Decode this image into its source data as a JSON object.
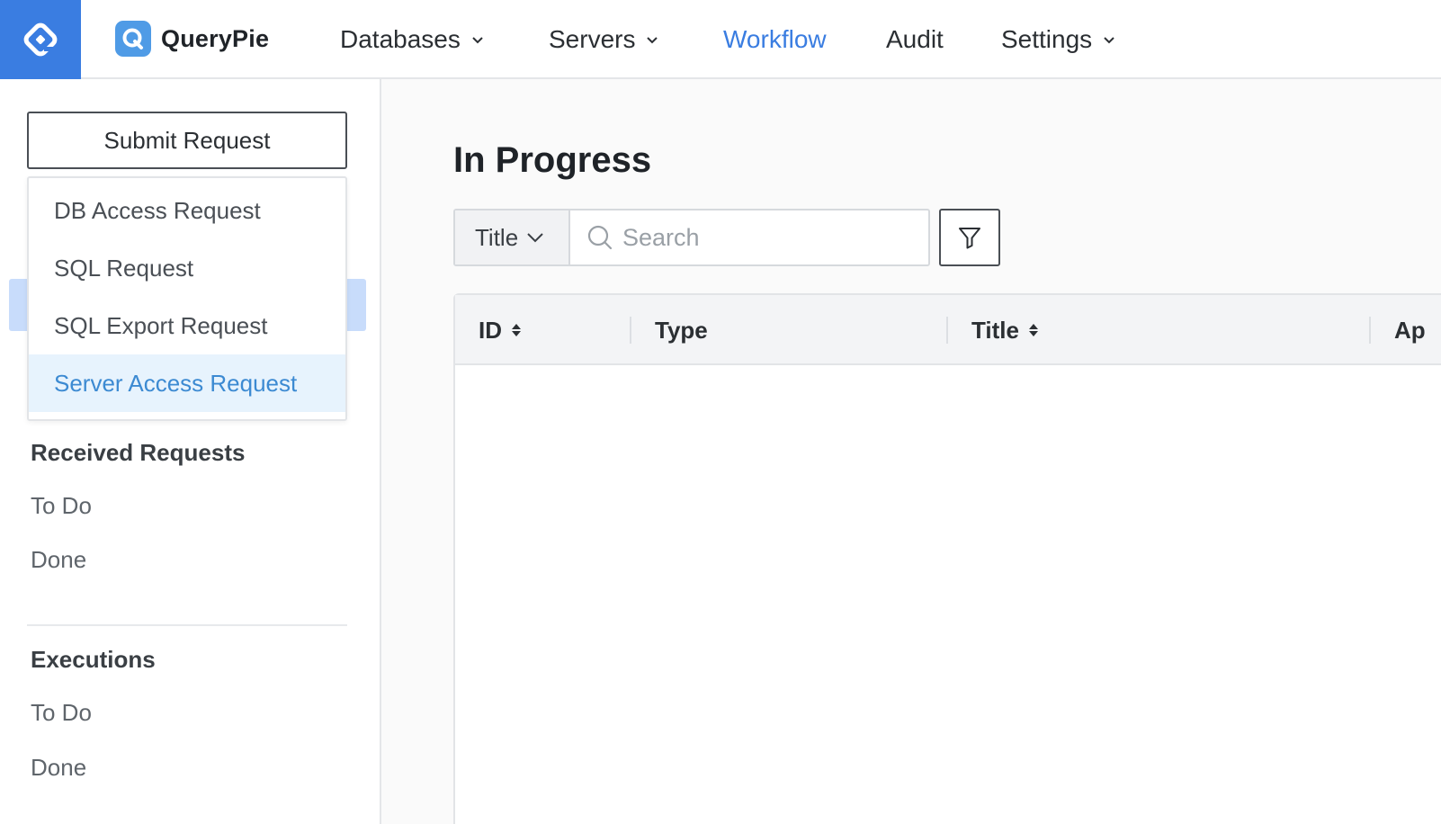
{
  "brand": {
    "name": "QueryPie",
    "logo_letter": "Q"
  },
  "nav": {
    "items": [
      {
        "label": "Databases",
        "has_dropdown": true
      },
      {
        "label": "Servers",
        "has_dropdown": true
      },
      {
        "label": "Workflow",
        "has_dropdown": false,
        "active": true
      },
      {
        "label": "Audit",
        "has_dropdown": false
      },
      {
        "label": "Settings",
        "has_dropdown": true
      }
    ]
  },
  "sidebar": {
    "submit_label": "Submit Request",
    "submit_menu": [
      {
        "label": "DB Access Request"
      },
      {
        "label": "SQL Request"
      },
      {
        "label": "SQL Export Request"
      },
      {
        "label": "Server Access Request",
        "selected": true
      }
    ],
    "received": {
      "heading": "Received Requests",
      "items": [
        {
          "label": "To Do"
        },
        {
          "label": "Done"
        }
      ]
    },
    "executions": {
      "heading": "Executions",
      "items": [
        {
          "label": "To Do"
        },
        {
          "label": "Done"
        }
      ]
    }
  },
  "main": {
    "title": "In Progress",
    "search": {
      "field": "Title",
      "placeholder": "Search",
      "value": ""
    },
    "table": {
      "columns": [
        {
          "label": "ID",
          "sortable": true
        },
        {
          "label": "Type",
          "sortable": false
        },
        {
          "label": "Title",
          "sortable": true
        },
        {
          "label": "Ap",
          "sortable": false
        }
      ],
      "rows": []
    }
  },
  "colors": {
    "accent": "#3a7de1",
    "menu_selected_bg": "#e7f3fd",
    "menu_selected_text": "#3c8ad2"
  }
}
